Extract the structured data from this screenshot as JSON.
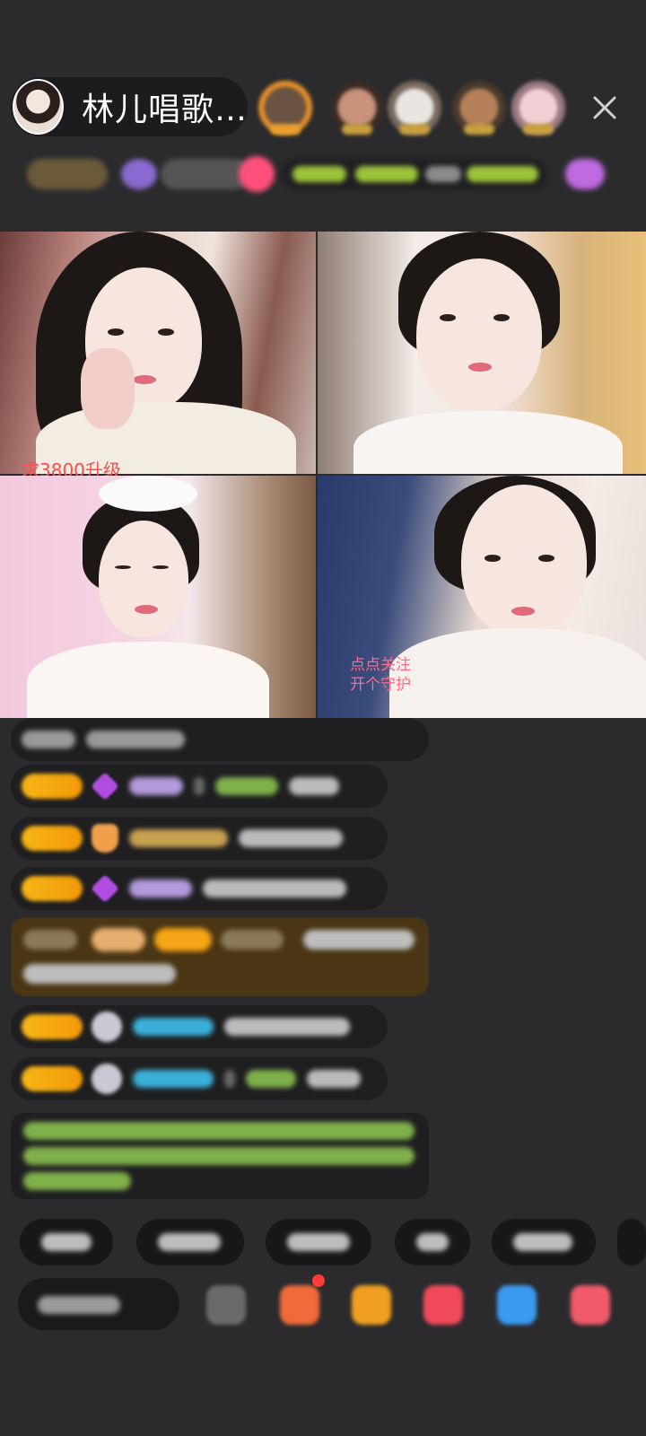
{
  "header": {
    "host_name": "林儿唱歌…",
    "close_icon": "close-icon"
  },
  "video_grid": {
    "tiles": [
      {
        "overlay_text": "求3800升级"
      },
      {
        "overlay_text": ""
      },
      {
        "overlay_text": ""
      },
      {
        "overlay_lines": [
          "点点关注",
          "开个守护"
        ]
      }
    ]
  },
  "colors": {
    "background": "#2b2b2d",
    "badge_gold": "#f7b515",
    "overlay_red": "#ff4b4b",
    "overlay_pink": "#ff6b8a"
  }
}
